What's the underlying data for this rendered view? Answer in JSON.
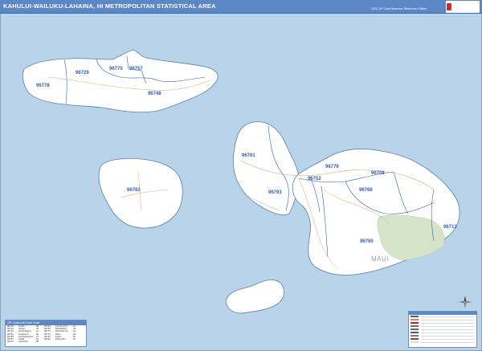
{
  "title": "KAHULUI-WAILUKU-LAHAINA, HI METROPOLITAN STATISTICAL AREA",
  "edition": "2020 ZIP Code Business Reference Edition",
  "island_label": "MAUI",
  "colors": {
    "water": "#b9d4ea",
    "land": "#ffffff",
    "title_bar": "#5b87c7",
    "zip_label": "#2f5fb0",
    "park": "#d6e5c8",
    "road": "#e0a86a"
  },
  "zip_codes": [
    "96770",
    "96757",
    "96729",
    "96778",
    "96748",
    "96761",
    "96752",
    "96779",
    "96708",
    "96793",
    "96763",
    "96768",
    "96790",
    "96713"
  ],
  "zip_table": {
    "header": "ZIP Code/Unit/Count Chart",
    "rows": [
      [
        "96708",
        "HAIKU",
        "38",
        "96763",
        "LANAI CITY",
        "21"
      ],
      [
        "96713",
        "HANA",
        "42",
        "96768",
        "MAKAWAO",
        "33"
      ],
      [
        "96729",
        "HOOLEHUA",
        "12",
        "96770",
        "MAUNALOA",
        "14"
      ],
      [
        "96732",
        "KAHULUI",
        "56",
        "96779",
        "PAIA",
        "25"
      ],
      [
        "96748",
        "KAUNAKAKAI",
        "27",
        "96790",
        "KULA",
        "18"
      ],
      [
        "96753",
        "KIHEI",
        "64",
        "96793",
        "WAILUKU",
        "61"
      ],
      [
        "96761",
        "LAHAINA",
        "58",
        "",
        "",
        ""
      ]
    ]
  },
  "legend": {
    "swatches": [
      "#3a5fa8",
      "#e08a2a",
      "#9a2a2a",
      "#c83a8a",
      "#2a8a3a",
      "#555555",
      "#7a7a7a",
      "#ad3a3a",
      "#d6e5c8"
    ]
  }
}
